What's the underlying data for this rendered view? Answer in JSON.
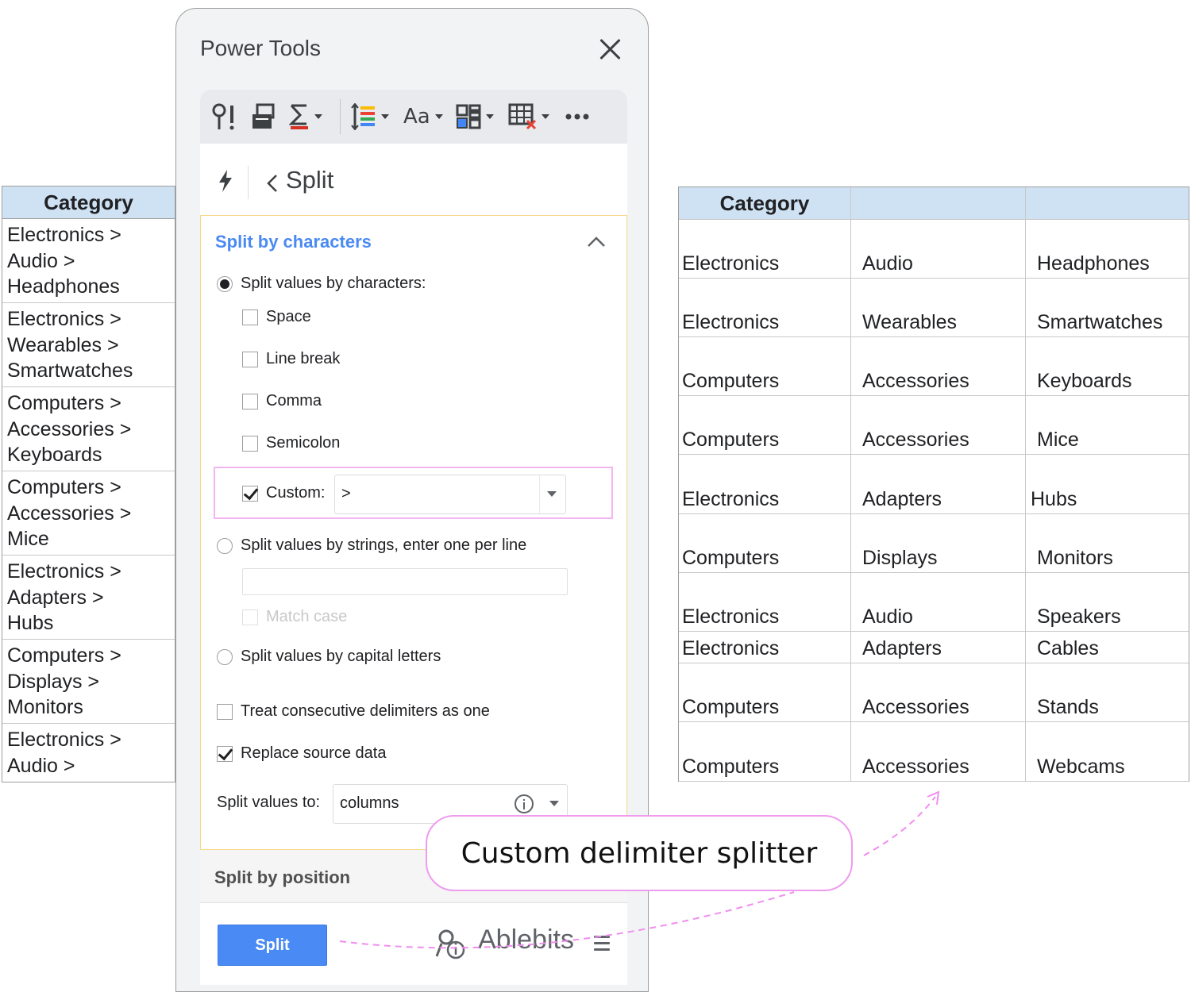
{
  "left_sheet": {
    "header": "Category",
    "rows": [
      [
        "Electronics >",
        "Audio >",
        "Headphones"
      ],
      [
        "Electronics >",
        "Wearables >",
        "Smartwatches"
      ],
      [
        "Computers >",
        "Accessories >",
        "Keyboards"
      ],
      [
        "Computers >",
        "Accessories >",
        "Mice"
      ],
      [
        "Electronics >",
        "Adapters >",
        "Hubs"
      ],
      [
        "Computers >",
        "Displays >",
        "Monitors"
      ],
      [
        "Electronics >",
        "Audio >"
      ]
    ]
  },
  "right_sheet": {
    "headers": [
      "Category",
      "",
      ""
    ],
    "rows": [
      [
        "Electronics",
        "Audio",
        "Headphones"
      ],
      [
        "Electronics",
        "Wearables",
        "Smartwatches"
      ],
      [
        "Computers",
        "Accessories",
        "Keyboards"
      ],
      [
        "Computers",
        "Accessories",
        "Mice"
      ],
      [
        "Electronics",
        "Adapters",
        "Hubs"
      ],
      [
        "Computers",
        "Displays",
        "Monitors"
      ],
      [
        "Electronics",
        "Audio",
        "Speakers"
      ],
      [
        "Electronics",
        "Adapters",
        "Cables"
      ],
      [
        "Computers",
        "Accessories",
        "Stands"
      ],
      [
        "Computers",
        "Accessories",
        "Webcams"
      ]
    ]
  },
  "panel": {
    "title": "Power Tools",
    "toolbar_icons": [
      "question-exclaim-icon",
      "clean-sheet-icon",
      "sum-icon",
      "sort-icon",
      "text-case-icon",
      "grid-layout-icon",
      "table-delete-icon",
      "more-icon"
    ],
    "nav": {
      "title": "Split"
    },
    "section_title": "Split by characters",
    "options": {
      "split_by_chars": "Split values by characters:",
      "space": "Space",
      "line_break": "Line break",
      "comma": "Comma",
      "semicolon": "Semicolon",
      "custom_label": "Custom:",
      "custom_value": ">",
      "split_by_strings": "Split values by strings, enter one per line",
      "match_case": "Match case",
      "split_by_capitals": "Split values by capital letters",
      "treat_consecutive": "Treat consecutive delimiters as one",
      "replace_source": "Replace source data",
      "split_to_label": "Split values to:",
      "split_to_value": "columns"
    },
    "position_section": "Split by position",
    "split_button": "Split",
    "brand": "Ablebits"
  },
  "callout": {
    "text": "Custom delimiter splitter"
  },
  "colors": {
    "accent_blue": "#4a8af4",
    "header_fill": "#cfe2f3",
    "callout_border": "#ee9ced",
    "section_border": "#f7d789"
  }
}
